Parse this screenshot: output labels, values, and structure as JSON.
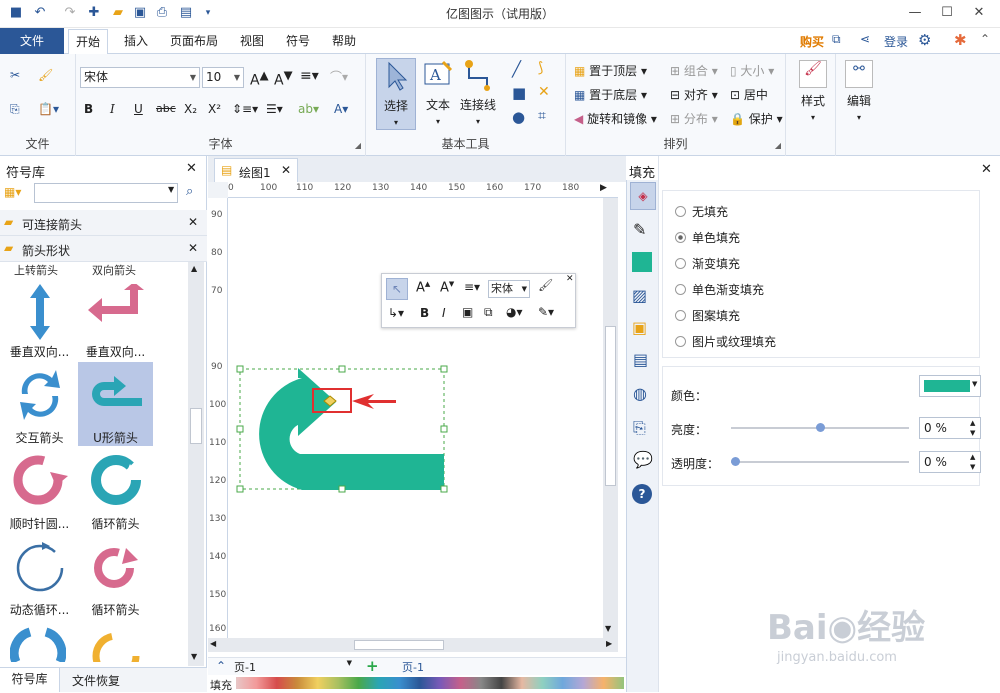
{
  "app": {
    "title": "亿图图示（试用版）"
  },
  "menu": {
    "file": "文件",
    "tabs": [
      "开始",
      "插入",
      "页面布局",
      "视图",
      "符号",
      "帮助"
    ],
    "buy": "购买",
    "login": "登录"
  },
  "ribbon": {
    "groups": {
      "file": "文件",
      "font": "字体",
      "basic": "基本工具",
      "arrange": "排列"
    },
    "font_name": "宋体",
    "font_size": "10",
    "tools": {
      "select": "选择",
      "text": "文本",
      "connector": "连接线"
    },
    "arrange": {
      "front": "置于顶层",
      "back": "置于底层",
      "rotate": "旋转和镜像",
      "group": "组合",
      "align": "对齐",
      "distribute": "分布",
      "size": "大小",
      "center": "居中",
      "protect": "保护"
    },
    "style": "样式",
    "edit": "编辑"
  },
  "library": {
    "title": "符号库",
    "search_placeholder": "",
    "categories": [
      "可连接箭头",
      "箭头形状"
    ],
    "partial_top": [
      "上转箭头",
      "双向箭头"
    ],
    "shapes": [
      {
        "label": "垂直双向...",
        "icon": "vertical-double-arrow-icon",
        "color": "#3a8fce"
      },
      {
        "label": "垂直双向...",
        "icon": "vertical-bend-arrow-icon",
        "color": "#d76a8e"
      },
      {
        "label": "交互箭头",
        "icon": "interaction-arrow-icon",
        "color": "#3a8fce"
      },
      {
        "label": "U形箭头",
        "icon": "u-arrow-icon",
        "color": "#2aa5b5"
      },
      {
        "label": "顺时针圆...",
        "icon": "clockwise-circle-arrow-icon",
        "color": "#d76a8e"
      },
      {
        "label": "循环箭头",
        "icon": "cycle-arrow-icon",
        "color": "#2aa5b5"
      },
      {
        "label": "动态循环...",
        "icon": "dynamic-cycle-arrow-icon",
        "color": "#3a6fa5"
      },
      {
        "label": "循环箭头",
        "icon": "cycle-arrow-2-icon",
        "color": "#d76a8e"
      }
    ],
    "bottom_tabs": [
      "符号库",
      "文件恢复"
    ]
  },
  "document": {
    "tab": "绘图1",
    "page": "页-1",
    "page_tab": "页-1",
    "fill_label": "填充"
  },
  "ruler": {
    "h": [
      "0",
      "100",
      "110",
      "120",
      "130",
      "140",
      "150",
      "160",
      "170",
      "180"
    ],
    "v": [
      "90",
      "80",
      "70",
      "90",
      "100",
      "110",
      "120",
      "130",
      "140",
      "150",
      "160"
    ]
  },
  "floatbar": {
    "font": "宋体"
  },
  "fill": {
    "title": "填充",
    "options": [
      "无填充",
      "单色填充",
      "渐变填充",
      "单色渐变填充",
      "图案填充",
      "图片或纹理填充"
    ],
    "selected": 1,
    "color_label": "颜色：",
    "color": "#1fb594",
    "brightness_label": "亮度：",
    "brightness": "0 %",
    "brightness_level": 0.5,
    "transparency_label": "透明度：",
    "transparency": "0 %",
    "transparency_level": 0.0
  },
  "colors": {
    "accent": "#2b5797",
    "shape": "#1fb594",
    "annotation": "#e03030"
  }
}
